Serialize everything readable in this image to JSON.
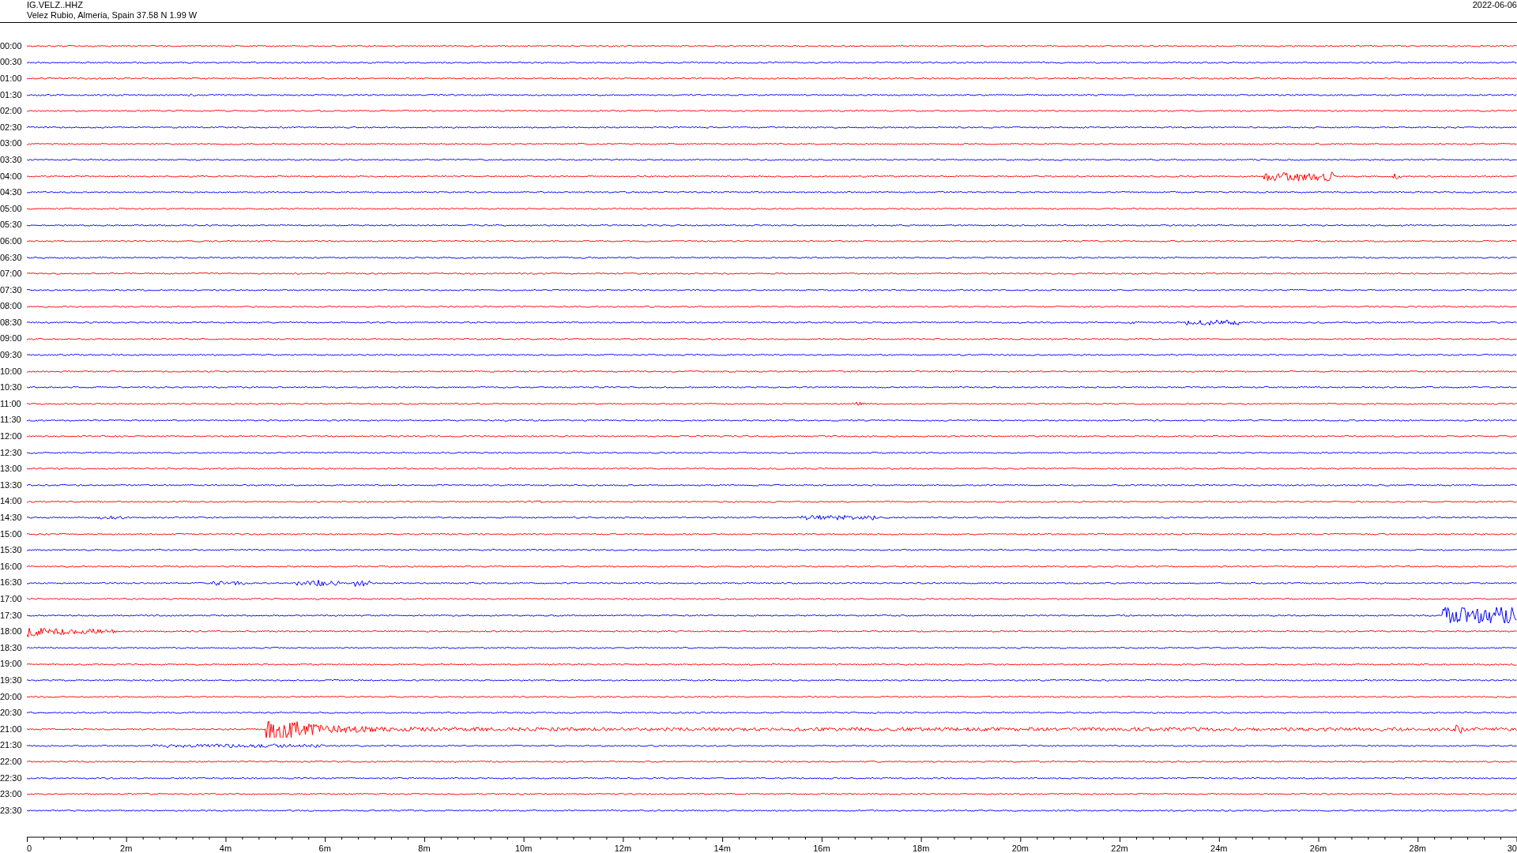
{
  "header": {
    "station": "IG.VELZ..HHZ",
    "location": "Velez Rubio, Almeria, Spain  37.58 N 1.99 W",
    "date": "2022-06-06"
  },
  "rows": [
    {
      "time": "00:00",
      "color": "#ff0000"
    },
    {
      "time": "00:30",
      "color": "#0000ff"
    },
    {
      "time": "01:00",
      "color": "#ff0000"
    },
    {
      "time": "01:30",
      "color": "#0000ff"
    },
    {
      "time": "02:00",
      "color": "#ff0000"
    },
    {
      "time": "02:30",
      "color": "#0000ff"
    },
    {
      "time": "03:00",
      "color": "#ff0000"
    },
    {
      "time": "03:30",
      "color": "#0000ff"
    },
    {
      "time": "04:00",
      "color": "#ff0000"
    },
    {
      "time": "04:30",
      "color": "#0000ff"
    },
    {
      "time": "05:00",
      "color": "#ff0000"
    },
    {
      "time": "05:30",
      "color": "#0000ff"
    },
    {
      "time": "06:00",
      "color": "#ff0000"
    },
    {
      "time": "06:30",
      "color": "#0000ff"
    },
    {
      "time": "07:00",
      "color": "#ff0000"
    },
    {
      "time": "07:30",
      "color": "#0000ff"
    },
    {
      "time": "08:00",
      "color": "#ff0000"
    },
    {
      "time": "08:30",
      "color": "#0000ff"
    },
    {
      "time": "09:00",
      "color": "#ff0000"
    },
    {
      "time": "09:30",
      "color": "#0000ff"
    },
    {
      "time": "10:00",
      "color": "#ff0000"
    },
    {
      "time": "10:30",
      "color": "#0000ff"
    },
    {
      "time": "11:00",
      "color": "#ff0000"
    },
    {
      "time": "11:30",
      "color": "#0000ff"
    },
    {
      "time": "12:00",
      "color": "#ff0000"
    },
    {
      "time": "12:30",
      "color": "#0000ff"
    },
    {
      "time": "13:00",
      "color": "#ff0000"
    },
    {
      "time": "13:30",
      "color": "#0000ff"
    },
    {
      "time": "14:00",
      "color": "#ff0000"
    },
    {
      "time": "14:30",
      "color": "#0000ff"
    },
    {
      "time": "15:00",
      "color": "#ff0000"
    },
    {
      "time": "15:30",
      "color": "#0000ff"
    },
    {
      "time": "16:00",
      "color": "#ff0000"
    },
    {
      "time": "16:30",
      "color": "#0000ff"
    },
    {
      "time": "17:00",
      "color": "#ff0000"
    },
    {
      "time": "17:30",
      "color": "#0000ff"
    },
    {
      "time": "18:00",
      "color": "#ff0000"
    },
    {
      "time": "18:30",
      "color": "#0000ff"
    },
    {
      "time": "19:00",
      "color": "#ff0000"
    },
    {
      "time": "19:30",
      "color": "#0000ff"
    },
    {
      "time": "20:00",
      "color": "#ff0000"
    },
    {
      "time": "20:30",
      "color": "#0000ff"
    },
    {
      "time": "21:00",
      "color": "#ff0000"
    },
    {
      "time": "21:30",
      "color": "#0000ff"
    },
    {
      "time": "22:00",
      "color": "#ff0000"
    },
    {
      "time": "22:30",
      "color": "#0000ff"
    },
    {
      "time": "23:00",
      "color": "#ff0000"
    },
    {
      "time": "23:30",
      "color": "#0000ff"
    }
  ],
  "x_axis": {
    "labels": [
      "0",
      "2m",
      "4m",
      "6m",
      "8m",
      "10m",
      "12m",
      "14m",
      "16m",
      "18m",
      "20m",
      "22m",
      "24m",
      "26m",
      "28m",
      "30"
    ]
  }
}
